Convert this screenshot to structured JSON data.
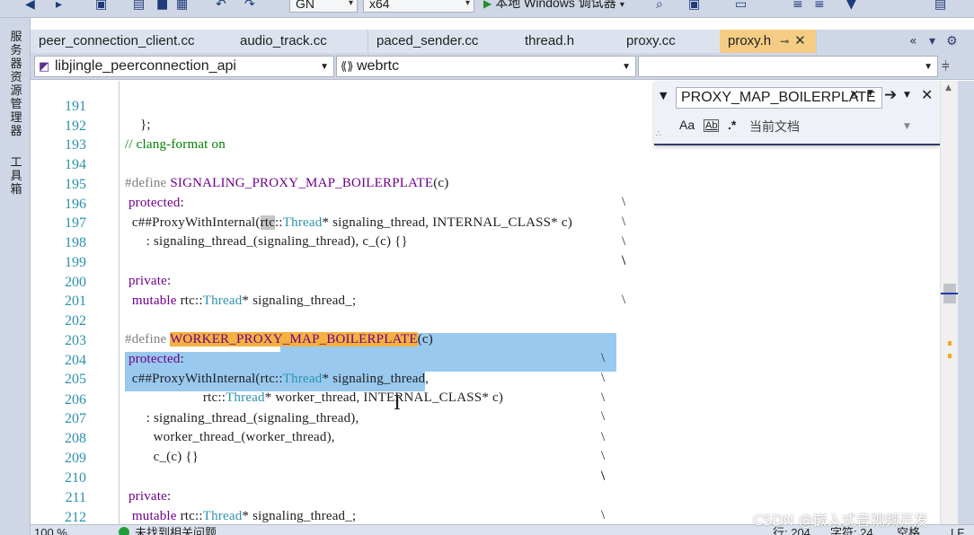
{
  "toolbar": {
    "config_value": "GN",
    "platform_value": "x64",
    "run_label": "本地 Windows 调试器"
  },
  "left_rail": {
    "server_explorer": "服务器资源管理器",
    "toolbox": "工具箱"
  },
  "tabs": [
    {
      "label": "peer_connection_client.cc",
      "active": false
    },
    {
      "label": "audio_track.cc",
      "active": false
    },
    {
      "label": "paced_sender.cc",
      "active": false
    },
    {
      "label": "thread.h",
      "active": false
    },
    {
      "label": "proxy.cc",
      "active": false
    },
    {
      "label": "proxy.h",
      "active": true
    }
  ],
  "tab_controls": {
    "pin": "⊸",
    "close": "✕",
    "overflow": "«",
    "dropdown": "▾",
    "settings": "⚙"
  },
  "nav": {
    "project": "libjingle_peerconnection_api",
    "scope": "webrtc",
    "member": ""
  },
  "find": {
    "query": "PROXY_MAP_BOILERPLATE",
    "match_case_label": "Aa",
    "whole_word_label": "Ab",
    "regex_label": ".*",
    "scope_label": "当前文档"
  },
  "code": {
    "lines": [
      {
        "n": "191",
        "text": " };"
      },
      {
        "n": "192",
        "text": "// clang-format on"
      },
      {
        "n": "193",
        "text": ""
      },
      {
        "n": "194",
        "text": "#define SIGNALING_PROXY_MAP_BOILERPLATE(c)"
      },
      {
        "n": "195",
        "text": " protected:"
      },
      {
        "n": "196",
        "text": "  c##ProxyWithInternal(rtc::Thread* signaling_thread, INTERNAL_CLASS* c)"
      },
      {
        "n": "197",
        "text": "      : signaling_thread_(signaling_thread), c_(c) {}"
      },
      {
        "n": "198",
        "text": ""
      },
      {
        "n": "199",
        "text": " private:"
      },
      {
        "n": "200",
        "text": "  mutable rtc::Thread* signaling_thread_;"
      },
      {
        "n": "201",
        "text": ""
      },
      {
        "n": "202",
        "text": "#define WORKER_PROXY_MAP_BOILERPLATE(c)"
      },
      {
        "n": "203",
        "text": " protected:"
      },
      {
        "n": "204",
        "text": "  c##ProxyWithInternal(rtc::Thread* signaling_thread,"
      },
      {
        "n": "205",
        "text": "                      rtc::Thread* worker_thread, INTERNAL_CLASS* c)"
      },
      {
        "n": "206",
        "text": "      : signaling_thread_(signaling_thread),"
      },
      {
        "n": "207",
        "text": "        worker_thread_(worker_thread),"
      },
      {
        "n": "208",
        "text": "        c_(c) {}"
      },
      {
        "n": "209",
        "text": ""
      },
      {
        "n": "210",
        "text": " private:"
      },
      {
        "n": "211",
        "text": "  mutable rtc::Thread* signaling_thread_;"
      },
      {
        "n": "212",
        "text": "  mutable rtc::Thread* worker_thread_;"
      },
      {
        "n": "213",
        "text": ""
      }
    ]
  },
  "status": {
    "zoom": "100 %",
    "issues": "未找到相关问题",
    "line": "行: 204",
    "char": "字符: 24",
    "spaces": "空格",
    "encoding": "LF"
  },
  "watermark": "CSDN @嵌入式音视频开发",
  "colors": {
    "active_tab": "#f5cc84",
    "chrome": "#cfd6e5",
    "selection": "#99c9ef",
    "find_highlight": "#f5b041",
    "macro": "#6f008a",
    "type": "#2b91af",
    "comment": "#008000",
    "line_number": "#2b91af"
  }
}
